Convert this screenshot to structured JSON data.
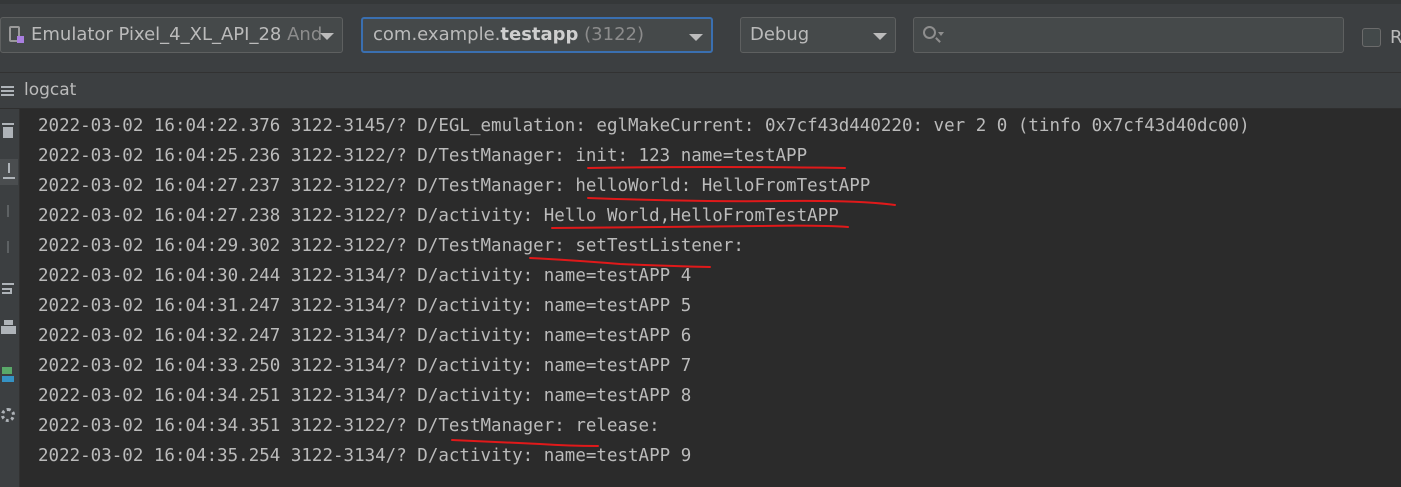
{
  "toolbar": {
    "device": {
      "name": "Emulator Pixel_4_XL_API_28",
      "suffix": " And"
    },
    "process": {
      "prefix": "com.example.",
      "app": "testapp",
      "pid": " (3122)"
    },
    "log_level": "Debug",
    "search": {
      "placeholder": "",
      "value": ""
    },
    "regex_label": "R"
  },
  "panel": {
    "title": "logcat"
  },
  "sidebar": {
    "icons": [
      "trash-icon",
      "scroll-to-end-icon",
      "up-icon",
      "down-icon",
      "soft-wrap-icon",
      "print-icon",
      "restart-icon",
      "gear-icon"
    ]
  },
  "log": {
    "lines": [
      "2022-03-02 16:04:22.376 3122-3145/? D/EGL_emulation: eglMakeCurrent: 0x7cf43d440220: ver 2 0 (tinfo 0x7cf43d40dc00)",
      "2022-03-02 16:04:25.236 3122-3122/? D/TestManager: init: 123 name=testAPP",
      "2022-03-02 16:04:27.237 3122-3122/? D/TestManager: helloWorld: HelloFromTestAPP",
      "2022-03-02 16:04:27.238 3122-3122/? D/activity: Hello World,HelloFromTestAPP",
      "2022-03-02 16:04:29.302 3122-3122/? D/TestManager: setTestListener:",
      "2022-03-02 16:04:30.244 3122-3134/? D/activity: name=testAPP 4",
      "2022-03-02 16:04:31.247 3122-3134/? D/activity: name=testAPP 5",
      "2022-03-02 16:04:32.247 3122-3134/? D/activity: name=testAPP 6",
      "2022-03-02 16:04:33.250 3122-3134/? D/activity: name=testAPP 7",
      "2022-03-02 16:04:34.251 3122-3134/? D/activity: name=testAPP 8",
      "2022-03-02 16:04:34.351 3122-3122/? D/TestManager: release:",
      "2022-03-02 16:04:35.254 3122-3134/? D/activity: name=testAPP 9"
    ]
  },
  "colors": {
    "background": "#2b2b2b",
    "toolbar": "#3c3f41",
    "text": "#bbbbbb",
    "focus_border": "#3a6fb0",
    "annotation": "#e0191a"
  }
}
